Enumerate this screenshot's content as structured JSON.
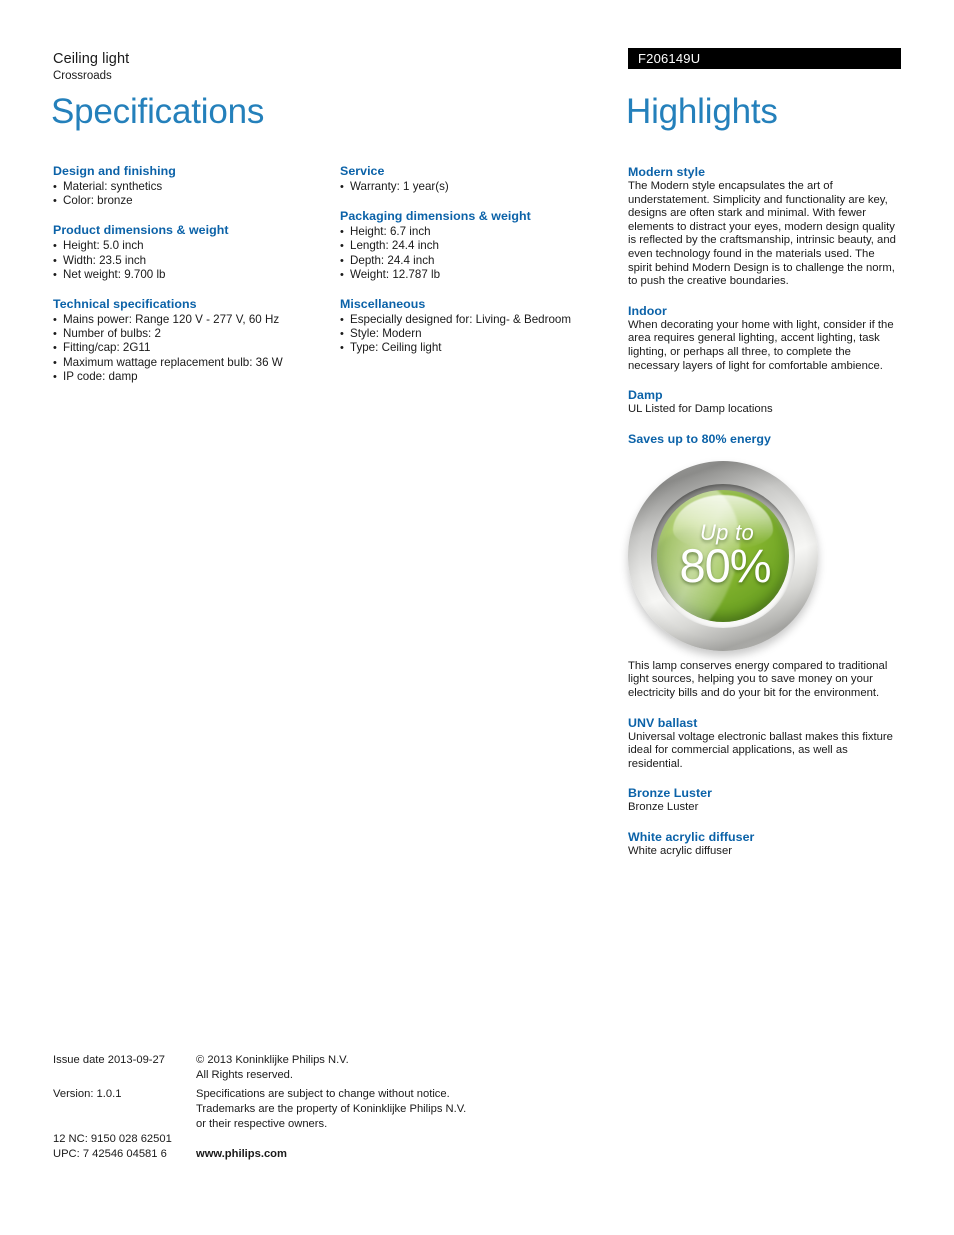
{
  "header": {
    "product_type": "Ceiling light",
    "product_name": "Crossroads",
    "model_number": "F206149U",
    "spec_title": "Specifications",
    "highlights_title": "Highlights"
  },
  "specifications": {
    "column1": [
      {
        "heading": "Design and finishing",
        "items": [
          "Material: synthetics",
          "Color: bronze"
        ]
      },
      {
        "heading": "Product dimensions & weight",
        "items": [
          "Height: 5.0 inch",
          "Width: 23.5 inch",
          "Net weight: 9.700 lb"
        ]
      },
      {
        "heading": "Technical specifications",
        "items": [
          "Mains power: Range 120 V - 277 V, 60 Hz",
          "Number of bulbs: 2",
          "Fitting/cap: 2G11",
          "Maximum wattage replacement bulb: 36 W",
          "IP code: damp"
        ]
      }
    ],
    "column2": [
      {
        "heading": "Service",
        "items": [
          "Warranty: 1 year(s)"
        ]
      },
      {
        "heading": "Packaging dimensions & weight",
        "items": [
          "Height: 6.7 inch",
          "Length: 24.4 inch",
          "Depth: 24.4 inch",
          "Weight: 12.787 lb"
        ]
      },
      {
        "heading": "Miscellaneous",
        "items": [
          "Especially designed for: Living- & Bedroom",
          "Style: Modern",
          "Type: Ceiling light"
        ]
      }
    ]
  },
  "highlights": [
    {
      "heading": "Modern style",
      "body": "The Modern style encapsulates the art of understatement. Simplicity and functionality are key, designs are often stark and minimal. With fewer elements to distract your eyes, modern design quality is reflected by the craftsmanship, intrinsic beauty, and even technology found in the materials used. The spirit behind Modern Design is to challenge the norm, to push the creative boundaries."
    },
    {
      "heading": "Indoor",
      "body": "When decorating your home with light, consider if the area requires general lighting, accent lighting, task lighting, or perhaps all three, to complete the necessary layers of light for comfortable ambience."
    },
    {
      "heading": "Damp",
      "body": "UL Listed for Damp locations"
    }
  ],
  "energy_section": {
    "heading": "Saves up to 80% energy",
    "badge": {
      "upper_text": "Up to",
      "percent_text": "80%",
      "green": "#8cbb34",
      "chrome": "#c9c9c7"
    },
    "body": "This lamp conserves energy compared to traditional light sources, helping you to save money on your electricity bills and do your bit for the environment."
  },
  "highlights_tail": [
    {
      "heading": "UNV ballast",
      "body": "Universal voltage electronic ballast makes this fixture ideal for commercial applications, as well as residential."
    },
    {
      "heading": "Bronze Luster",
      "body": "Bronze Luster"
    },
    {
      "heading": "White acrylic diffuser",
      "body": "White acrylic diffuser"
    }
  ],
  "footer": {
    "issue_date": "Issue date 2013-09-27",
    "copyright_line1": "© 2013 Koninklijke Philips N.V.",
    "copyright_line2": "All Rights reserved.",
    "version": "Version: 1.0.1",
    "disclaimer_line1": "Specifications are subject to change without notice.",
    "disclaimer_line2": "Trademarks are the property of Koninklijke Philips N.V.",
    "disclaimer_line3": "or their respective owners.",
    "nc_code": "12 NC: 9150 028 62501",
    "upc_code": "UPC: 7 42546 04581 6",
    "website": "www.philips.com"
  }
}
